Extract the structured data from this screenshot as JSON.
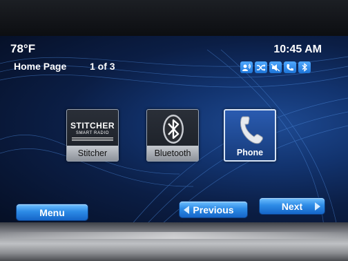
{
  "status": {
    "temperature": "78°F",
    "time": "10:45 AM"
  },
  "header": {
    "title": "Home Page",
    "page_indicator": "1 of 3"
  },
  "status_icons": [
    "voice-recognition-icon",
    "shuffle-icon",
    "mute-icon",
    "phone-icon",
    "bluetooth-icon"
  ],
  "tiles": [
    {
      "name": "stitcher",
      "label": "Stitcher",
      "logo_line1": "STITCHER",
      "logo_line2": "SMART RADIO"
    },
    {
      "name": "bluetooth",
      "label": "Bluetooth"
    },
    {
      "name": "phone",
      "label": "Phone"
    }
  ],
  "nav": {
    "menu": "Menu",
    "previous": "Previous",
    "next": "Next"
  },
  "colors": {
    "accent": "#2d8be6",
    "background": "#0b1e45"
  }
}
